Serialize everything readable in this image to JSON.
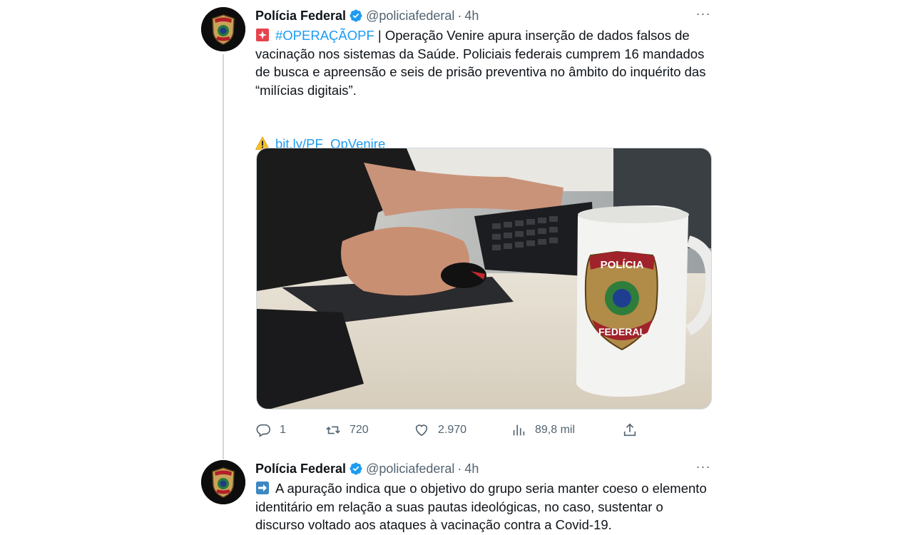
{
  "tweets": [
    {
      "author": {
        "name": "Polícia Federal",
        "handle": "@policiafederal",
        "dot": "·",
        "time": "4h"
      },
      "more": "···",
      "text": {
        "emoji": "siren-emoji",
        "hashtag": "#OPERAÇÃOPF",
        "body": " | Operação Venire apura inserção de dados falsos de vacinação nos sistemas da Saúde. Policiais federais cumprem 16 mandados de busca e apreensão e seis de prisão preventiva no âmbito do inquérito das “milícias digitais”.",
        "link_emoji": "warning-emoji",
        "link": "bit.ly/PF_OpVenire"
      },
      "media": {
        "badge_top": "POLÍCIA",
        "badge_bottom": "FEDERAL"
      },
      "actions": {
        "replies": "1",
        "retweets": "720",
        "likes": "2.970",
        "views": "89,8 mil"
      }
    },
    {
      "author": {
        "name": "Polícia Federal",
        "handle": "@policiafederal",
        "dot": "·",
        "time": "4h"
      },
      "more": "···",
      "text": {
        "emoji": "arrow-right-emoji",
        "body": "A apuração indica que o objetivo do grupo seria manter coeso o elemento identitário em relação a suas pautas ideológicas, no caso, sustentar o discurso voltado aos ataques à vacinação contra a Covid-19."
      }
    }
  ],
  "colors": {
    "accent": "#1d9bf0",
    "text": "#0f1419",
    "muted": "#536471",
    "border": "#cfd9de"
  }
}
